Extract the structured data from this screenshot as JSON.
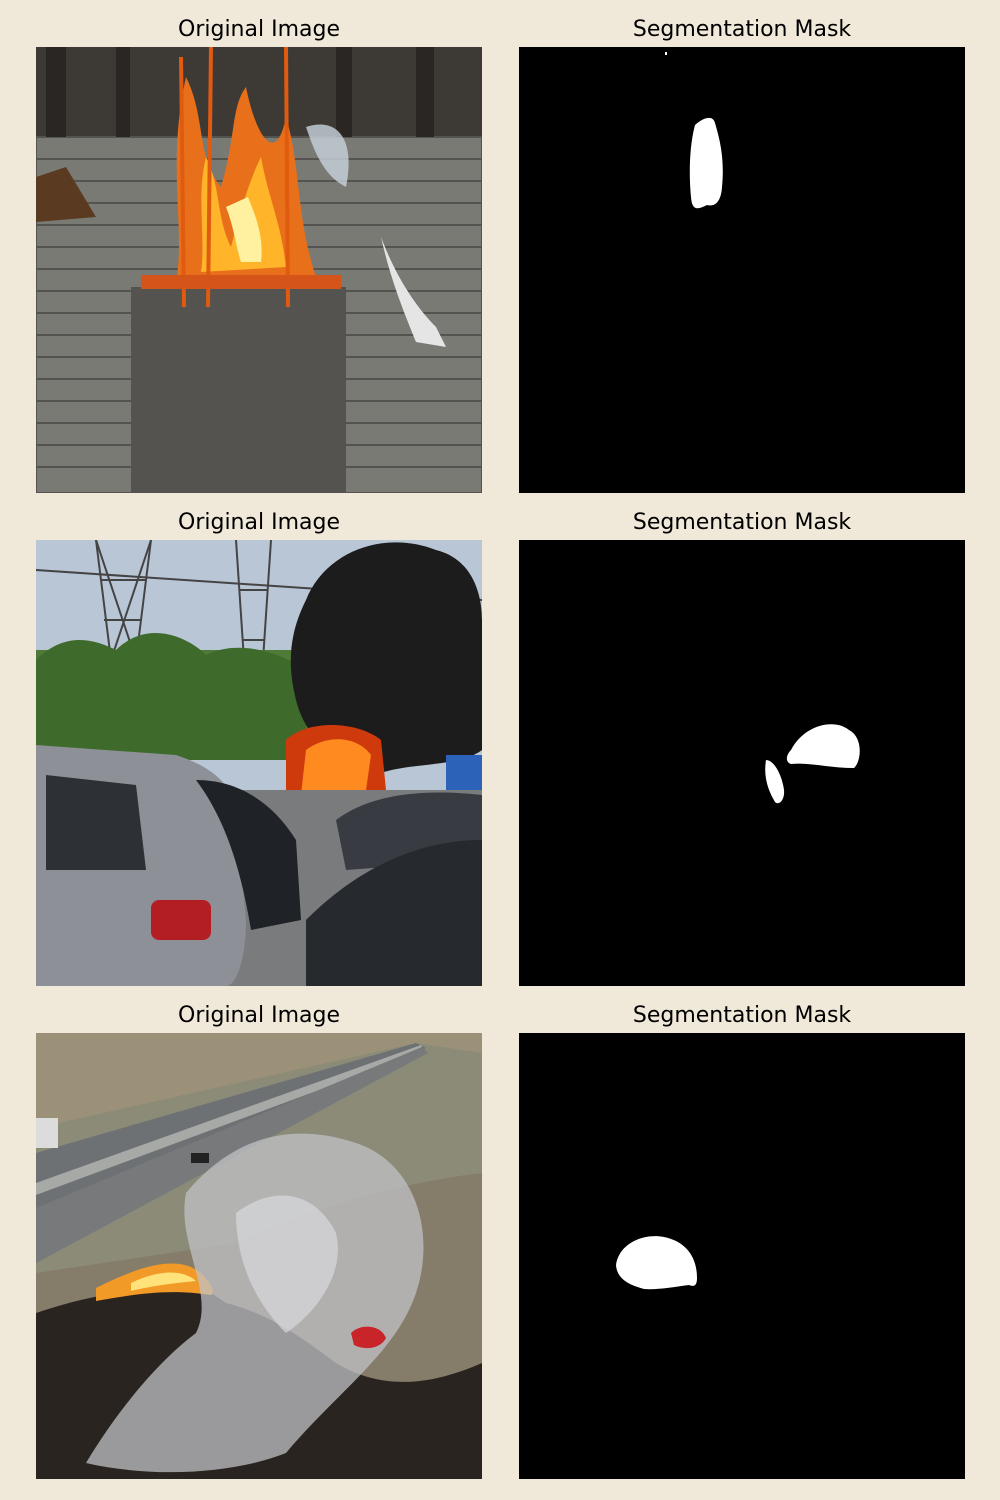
{
  "rows": [
    {
      "left_title": "Original Image",
      "right_title": "Segmentation Mask"
    },
    {
      "left_title": "Original Image",
      "right_title": "Segmentation Mask"
    },
    {
      "left_title": "Original Image",
      "right_title": "Segmentation Mask"
    }
  ],
  "colors": {
    "background": "#f0e8d8",
    "mask_bg": "#000000",
    "mask_fg": "#ffffff"
  }
}
